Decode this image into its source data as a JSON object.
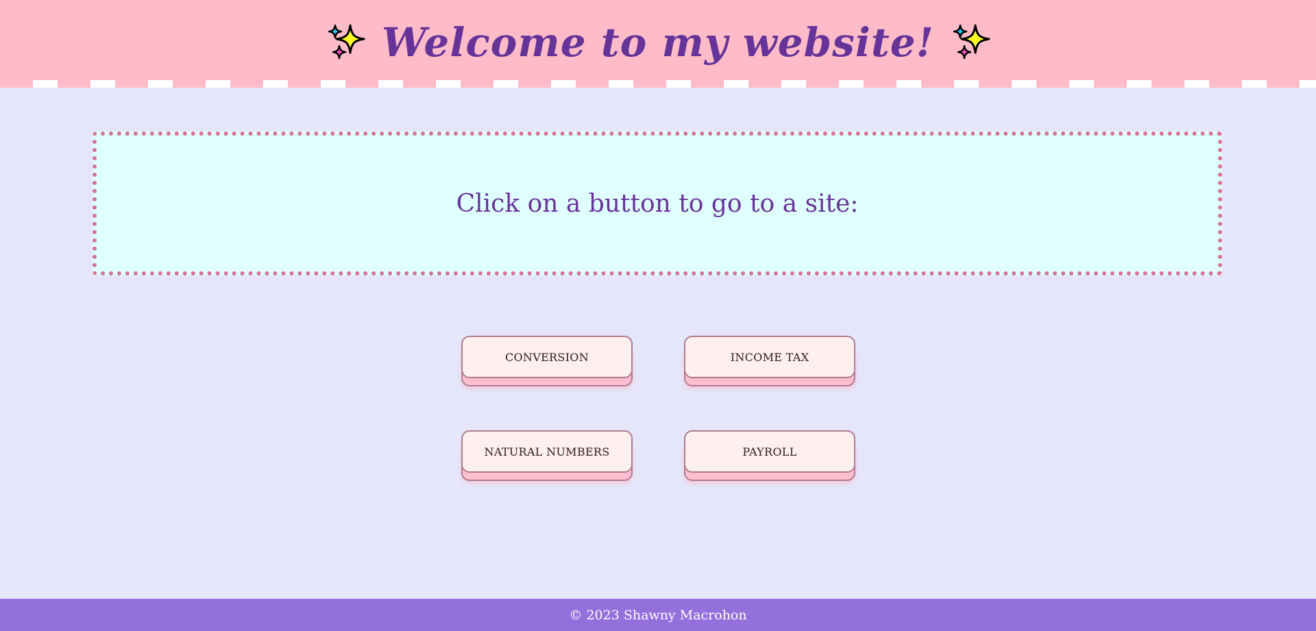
{
  "header": {
    "title": "Welcome to my website!",
    "left_icon": "sparkles-icon",
    "right_icon": "sparkles-icon",
    "background_color": "#ffbcc8",
    "title_color": "#663399"
  },
  "main": {
    "prompt": "Click on a button to go to a site:",
    "prompt_box_color": "#e0ffff",
    "prompt_border_color": "#db7093",
    "buttons": [
      {
        "label": "CONVERSION"
      },
      {
        "label": "INCOME TAX"
      },
      {
        "label": "NATURAL NUMBERS"
      },
      {
        "label": "PAYROLL"
      }
    ],
    "button_face_color": "#fff0f0",
    "button_base_color": "#ffbfd0"
  },
  "footer": {
    "text": "© 2023 Shawny Macrohon",
    "background_color": "#9370db"
  },
  "page_background": "#e6e6fa"
}
